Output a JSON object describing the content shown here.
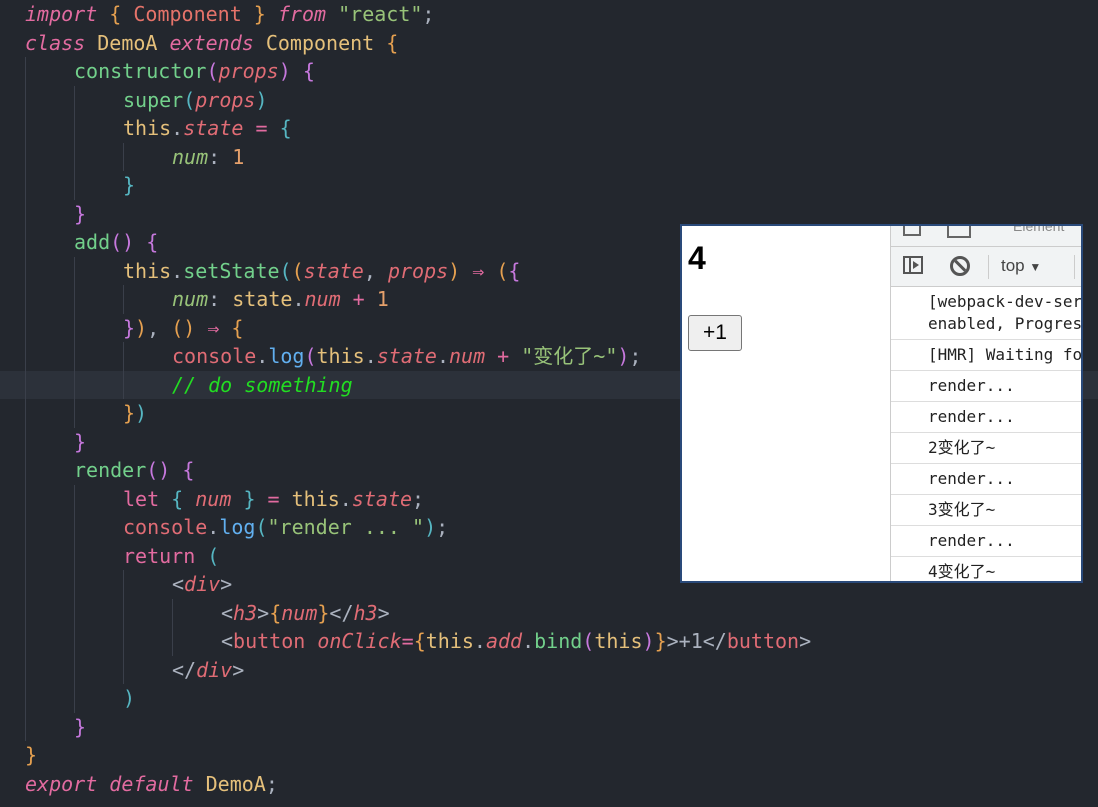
{
  "code": {
    "highlight_line": 13,
    "lines": [
      {
        "indent": 0,
        "tokens": [
          [
            "import",
            "kw"
          ],
          [
            " ",
            "p"
          ],
          [
            "{",
            "b1"
          ],
          [
            " Component ",
            "cls"
          ],
          [
            "}",
            "b1"
          ],
          [
            " ",
            "p"
          ],
          [
            "from",
            "kw"
          ],
          [
            " ",
            "p"
          ],
          [
            "\"react\"",
            "str"
          ],
          [
            ";",
            "p"
          ]
        ]
      },
      {
        "indent": 0,
        "tokens": [
          [
            "class",
            "kw"
          ],
          [
            " DemoA ",
            "type"
          ],
          [
            "extends",
            "kw"
          ],
          [
            " Component ",
            "type"
          ],
          [
            "{",
            "b1"
          ]
        ]
      },
      {
        "indent": 1,
        "tokens": [
          [
            "constructor",
            "fn"
          ],
          [
            "(",
            "b2"
          ],
          [
            "props",
            "param"
          ],
          [
            ")",
            "b2"
          ],
          [
            " ",
            "p"
          ],
          [
            "{",
            "b2"
          ]
        ]
      },
      {
        "indent": 2,
        "tokens": [
          [
            "super",
            "fn"
          ],
          [
            "(",
            "b3"
          ],
          [
            "props",
            "param"
          ],
          [
            ")",
            "b3"
          ]
        ]
      },
      {
        "indent": 2,
        "tokens": [
          [
            "this",
            "this"
          ],
          [
            ".",
            "p"
          ],
          [
            "state",
            "prop"
          ],
          [
            " = ",
            "op"
          ],
          [
            "{",
            "b3"
          ]
        ]
      },
      {
        "indent": 3,
        "tokens": [
          [
            "num",
            "key"
          ],
          [
            ": ",
            "p"
          ],
          [
            "1",
            "num"
          ]
        ]
      },
      {
        "indent": 2,
        "tokens": [
          [
            "}",
            "b3"
          ]
        ]
      },
      {
        "indent": 1,
        "tokens": [
          [
            "}",
            "b2"
          ]
        ]
      },
      {
        "indent": 1,
        "tokens": [
          [
            "add",
            "fn"
          ],
          [
            "()",
            "b2"
          ],
          [
            " ",
            "p"
          ],
          [
            "{",
            "b2"
          ]
        ]
      },
      {
        "indent": 2,
        "tokens": [
          [
            "this",
            "this"
          ],
          [
            ".",
            "p"
          ],
          [
            "setState",
            "fn"
          ],
          [
            "(",
            "b3"
          ],
          [
            "(",
            "b1"
          ],
          [
            "state",
            "param"
          ],
          [
            ", ",
            "p"
          ],
          [
            "props",
            "param"
          ],
          [
            ")",
            "b1"
          ],
          [
            " ⇒ ",
            "op"
          ],
          [
            "(",
            "b1"
          ],
          [
            "{",
            "b2"
          ]
        ]
      },
      {
        "indent": 3,
        "tokens": [
          [
            "num",
            "key"
          ],
          [
            ": ",
            "p"
          ],
          [
            "state",
            "this"
          ],
          [
            ".",
            "p"
          ],
          [
            "num",
            "prop"
          ],
          [
            " + ",
            "op"
          ],
          [
            "1",
            "num"
          ]
        ]
      },
      {
        "indent": 2,
        "tokens": [
          [
            "}",
            "b2"
          ],
          [
            ")",
            "b1"
          ],
          [
            ", ",
            "p"
          ],
          [
            "()",
            "b1"
          ],
          [
            " ⇒ ",
            "op"
          ],
          [
            "{",
            "b1"
          ]
        ]
      },
      {
        "indent": 3,
        "tokens": [
          [
            "console",
            "obj"
          ],
          [
            ".",
            "p"
          ],
          [
            "log",
            "meth"
          ],
          [
            "(",
            "b2"
          ],
          [
            "this",
            "this"
          ],
          [
            ".",
            "p"
          ],
          [
            "state",
            "prop"
          ],
          [
            ".",
            "p"
          ],
          [
            "num",
            "prop"
          ],
          [
            " + ",
            "op"
          ],
          [
            "\"变化了~\"",
            "str"
          ],
          [
            ")",
            "b2"
          ],
          [
            ";",
            "p"
          ]
        ]
      },
      {
        "indent": 3,
        "tokens": [
          [
            "// do something",
            "cm"
          ]
        ]
      },
      {
        "indent": 2,
        "tokens": [
          [
            "}",
            "b1"
          ],
          [
            ")",
            "b3"
          ]
        ]
      },
      {
        "indent": 1,
        "tokens": [
          [
            "}",
            "b2"
          ]
        ]
      },
      {
        "indent": 1,
        "tokens": [
          [
            "render",
            "fn"
          ],
          [
            "()",
            "b2"
          ],
          [
            " ",
            "p"
          ],
          [
            "{",
            "b2"
          ]
        ]
      },
      {
        "indent": 2,
        "tokens": [
          [
            "let",
            "kw2"
          ],
          [
            " ",
            "p"
          ],
          [
            "{",
            "b3"
          ],
          [
            " num ",
            "param"
          ],
          [
            "}",
            "b3"
          ],
          [
            " = ",
            "op"
          ],
          [
            "this",
            "this"
          ],
          [
            ".",
            "p"
          ],
          [
            "state",
            "prop"
          ],
          [
            ";",
            "p"
          ]
        ]
      },
      {
        "indent": 2,
        "tokens": [
          [
            "console",
            "obj"
          ],
          [
            ".",
            "p"
          ],
          [
            "log",
            "meth"
          ],
          [
            "(",
            "b3"
          ],
          [
            "\"render ... \"",
            "str"
          ],
          [
            ")",
            "b3"
          ],
          [
            ";",
            "p"
          ]
        ]
      },
      {
        "indent": 2,
        "tokens": [
          [
            "return",
            "kw2"
          ],
          [
            " ",
            "p"
          ],
          [
            "(",
            "b3"
          ]
        ]
      },
      {
        "indent": 3,
        "tokens": [
          [
            "<",
            "p"
          ],
          [
            "div",
            "tag"
          ],
          [
            ">",
            "p"
          ]
        ]
      },
      {
        "indent": 4,
        "tokens": [
          [
            "<",
            "p"
          ],
          [
            "h3",
            "tag"
          ],
          [
            ">",
            "p"
          ],
          [
            "{",
            "b1"
          ],
          [
            "num",
            "param"
          ],
          [
            "}",
            "b1"
          ],
          [
            "</",
            "p"
          ],
          [
            "h3",
            "tag"
          ],
          [
            ">",
            "p"
          ]
        ]
      },
      {
        "indent": 4,
        "tokens": [
          [
            "<",
            "p"
          ],
          [
            "button",
            "obj"
          ],
          [
            " ",
            "p"
          ],
          [
            "onClick",
            "param"
          ],
          [
            "=",
            "op"
          ],
          [
            "{",
            "b1"
          ],
          [
            "this",
            "this"
          ],
          [
            ".",
            "p"
          ],
          [
            "add",
            "prop"
          ],
          [
            ".",
            "p"
          ],
          [
            "bind",
            "fn"
          ],
          [
            "(",
            "b2"
          ],
          [
            "this",
            "this"
          ],
          [
            ")",
            "b2"
          ],
          [
            "}",
            "b1"
          ],
          [
            ">+1",
            "p"
          ],
          [
            "</",
            "p"
          ],
          [
            "button",
            "obj"
          ],
          [
            ">",
            "p"
          ]
        ]
      },
      {
        "indent": 3,
        "tokens": [
          [
            "</",
            "p"
          ],
          [
            "div",
            "tag"
          ],
          [
            ">",
            "p"
          ]
        ]
      },
      {
        "indent": 2,
        "tokens": [
          [
            ")",
            "b3"
          ]
        ]
      },
      {
        "indent": 1,
        "tokens": [
          [
            "}",
            "b2"
          ]
        ]
      },
      {
        "indent": 0,
        "tokens": [
          [
            "}",
            "b1"
          ]
        ]
      },
      {
        "indent": 0,
        "tokens": [
          [
            "export",
            "kw"
          ],
          [
            " ",
            "p"
          ],
          [
            "default",
            "kw"
          ],
          [
            " DemoA",
            "type"
          ],
          [
            ";",
            "p"
          ]
        ]
      }
    ]
  },
  "preview": {
    "num": "4",
    "button_label": "+1"
  },
  "devtools": {
    "tab_partial": "Element",
    "context": "top",
    "console_rows": [
      "[webpack-dev-server]\nenabled, Progress",
      "[HMR] Waiting for",
      "render...",
      "render...",
      "2变化了~",
      "render...",
      "3变化了~",
      "render...",
      "4变化了~"
    ]
  }
}
